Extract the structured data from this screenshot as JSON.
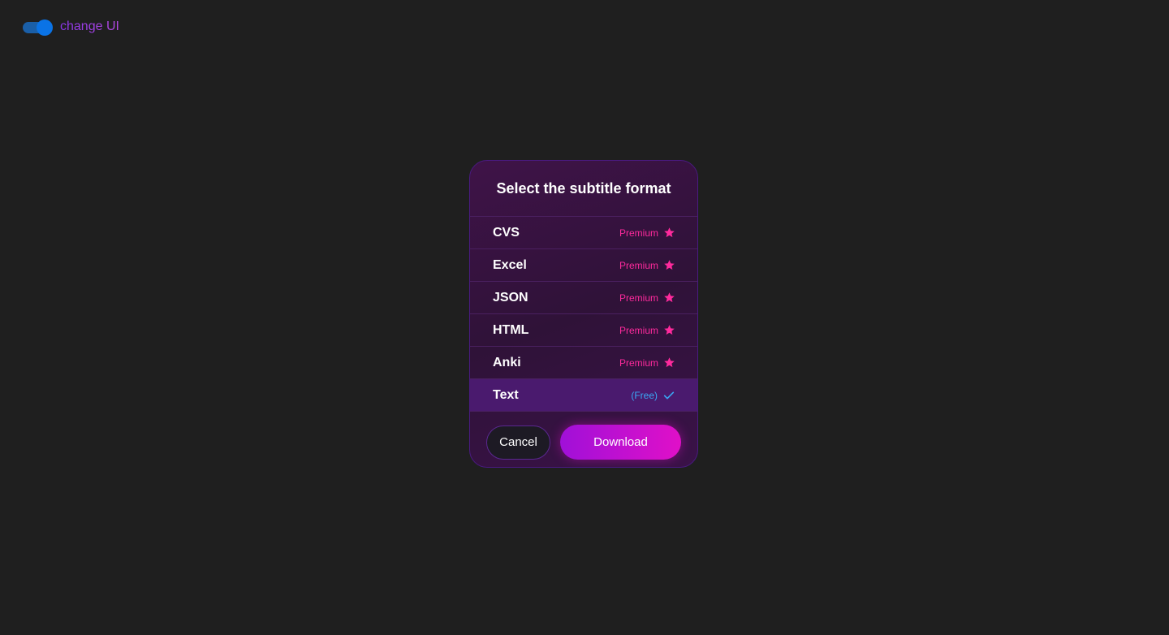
{
  "top_bar": {
    "toggle_on": true,
    "toggle_label": "change UI",
    "toggle_color": "#0a73e6",
    "label_color": "#8d3fe6"
  },
  "dialog": {
    "title": "Select the subtitle format",
    "formats": [
      {
        "name": "CVS",
        "tag": "Premium",
        "icon": "star-icon",
        "selected": false
      },
      {
        "name": "Excel",
        "tag": "Premium",
        "icon": "star-icon",
        "selected": false
      },
      {
        "name": "JSON",
        "tag": "Premium",
        "icon": "star-icon",
        "selected": false
      },
      {
        "name": "HTML",
        "tag": "Premium",
        "icon": "star-icon",
        "selected": false
      },
      {
        "name": "Anki",
        "tag": "Premium",
        "icon": "star-icon",
        "selected": false
      },
      {
        "name": "Text",
        "tag": "(Free)",
        "icon": "check-icon",
        "selected": true
      }
    ],
    "cancel_label": "Cancel",
    "download_label": "Download"
  },
  "colors": {
    "background": "#1f1f1f",
    "premium": "#ff2a9d",
    "free": "#3aa8f5",
    "accent_gradient_start": "#a010d8",
    "accent_gradient_end": "#e010c8",
    "dialog_border": "#4a1a82"
  }
}
